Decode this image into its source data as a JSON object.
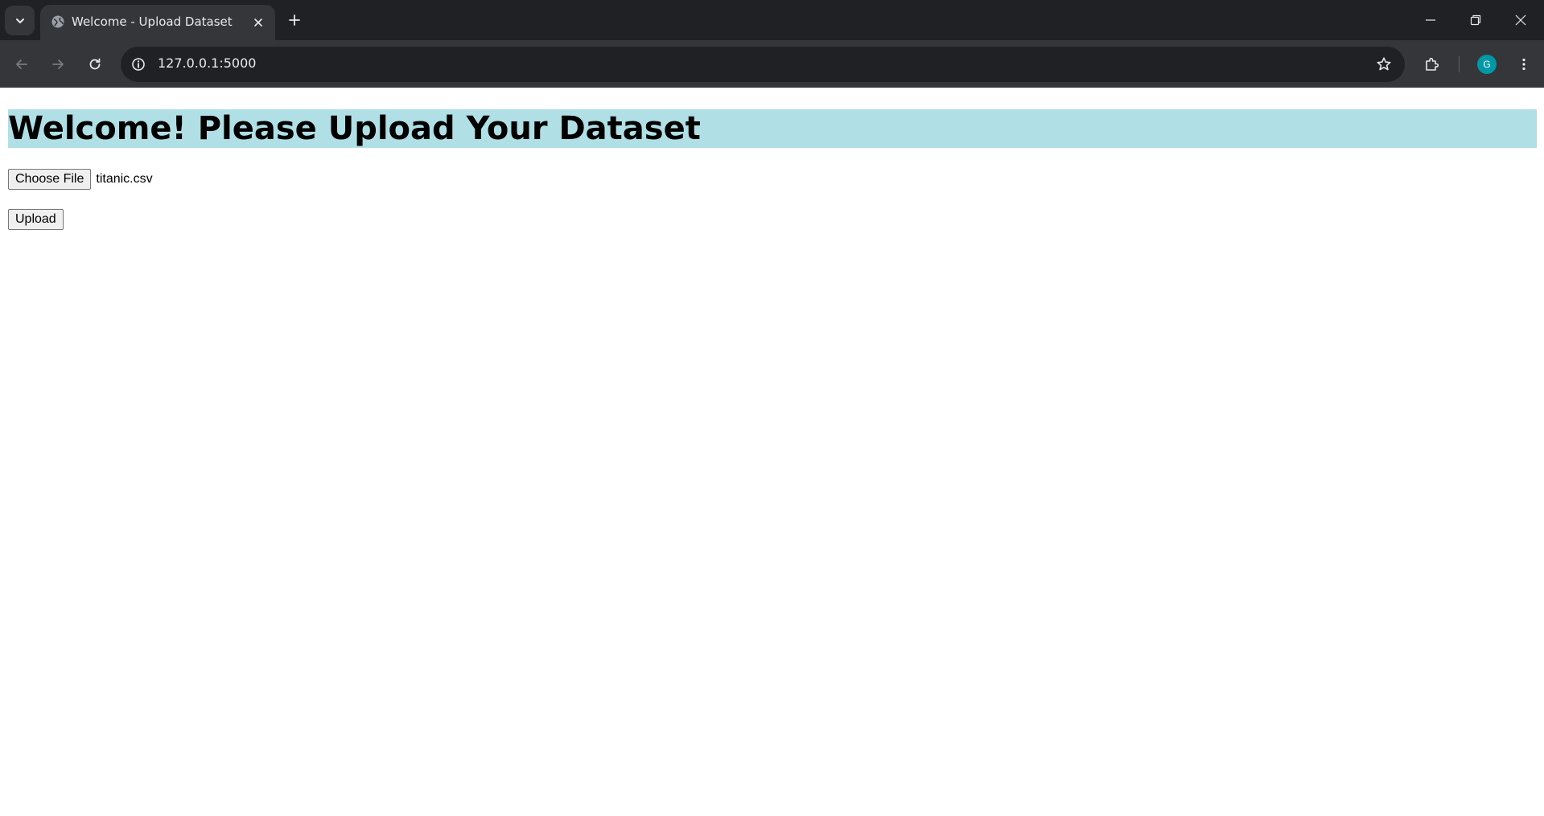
{
  "browser": {
    "tab": {
      "title": "Welcome - Upload Dataset",
      "favicon": "globe-icon"
    },
    "address_bar": {
      "url": "127.0.0.1:5000"
    },
    "profile": {
      "initial": "G",
      "color": "#0097a7"
    },
    "icons": {
      "tab_search": "chevron-down-icon",
      "close_tab": "close-icon",
      "new_tab": "plus-icon",
      "back": "arrow-left-icon",
      "forward": "arrow-right-icon",
      "reload": "reload-icon",
      "site_info": "info-icon",
      "bookmark": "star-icon",
      "extensions": "puzzle-icon",
      "menu": "kebab-menu-icon",
      "minimize": "minimize-icon",
      "restore": "restore-icon",
      "close_window": "close-icon"
    }
  },
  "page": {
    "heading": "Welcome! Please Upload Your Dataset",
    "heading_bg": "#b0e0e6",
    "file_input": {
      "button_label": "Choose File",
      "selected_file": "titanic.csv"
    },
    "upload_button": "Upload"
  }
}
